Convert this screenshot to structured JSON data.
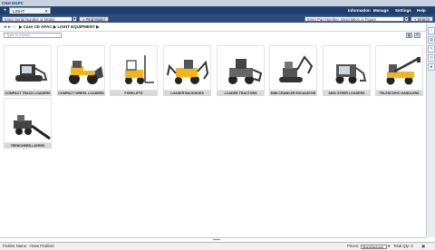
{
  "app": {
    "logo": "CNH NGPC"
  },
  "nav": {
    "new_tab_glyph": "+",
    "tab_label": "LIGHT EQUIPMENT",
    "tab_close": "✕",
    "menu": [
      "Information",
      "Manage",
      "Settings",
      "Help"
    ]
  },
  "search": {
    "serial_placeholder": "Enter Serial Number or Model",
    "find_model_label": "Find Model",
    "center_title": "NEXT GENERATION PARTS CATALOG",
    "part_placeholder": "Enter Part Number, Description or Figure",
    "search_label": "Search"
  },
  "breadcrumb": {
    "text": "▶ Case CE APAC  ▶ LIGHT EQUIPMENT  ▶"
  },
  "filter": {
    "placeholder": "Type to narrow"
  },
  "categories": [
    {
      "label": "COMPACT TRACK LOADERS",
      "icon": "track-loader-icon"
    },
    {
      "label": "COMPACT WHEEL LOADERS",
      "icon": "wheel-loader-icon"
    },
    {
      "label": "FORKLIFTS",
      "icon": "forklift-icon"
    },
    {
      "label": "LOADER BACKHOES",
      "icon": "backhoe-icon"
    },
    {
      "label": "LOADER TRACTORS",
      "icon": "loader-tractor-icon"
    },
    {
      "label": "MINI CRAWLER EXCAVATOR",
      "icon": "mini-excavator-icon"
    },
    {
      "label": "SKID STEER LOADERS",
      "icon": "skid-steer-icon"
    },
    {
      "label": "TELESCOPIC HANDLERS",
      "icon": "telehandler-icon"
    },
    {
      "label": "TRENCHERS-LAYERS",
      "icon": "trencher-icon"
    }
  ],
  "status": {
    "picklist_label": "Picklist Name:",
    "picklist_value": "<New Picklist>",
    "prices_label": "Prices:",
    "prices_value": "Manufacturer",
    "total_label": "Total Qty: 0"
  },
  "colors": {
    "nav": "#1f3f6e",
    "searchbar": "#2c4d7e",
    "label_bg": "#d9d9d9",
    "machine_yellow": "#f2b51c"
  }
}
